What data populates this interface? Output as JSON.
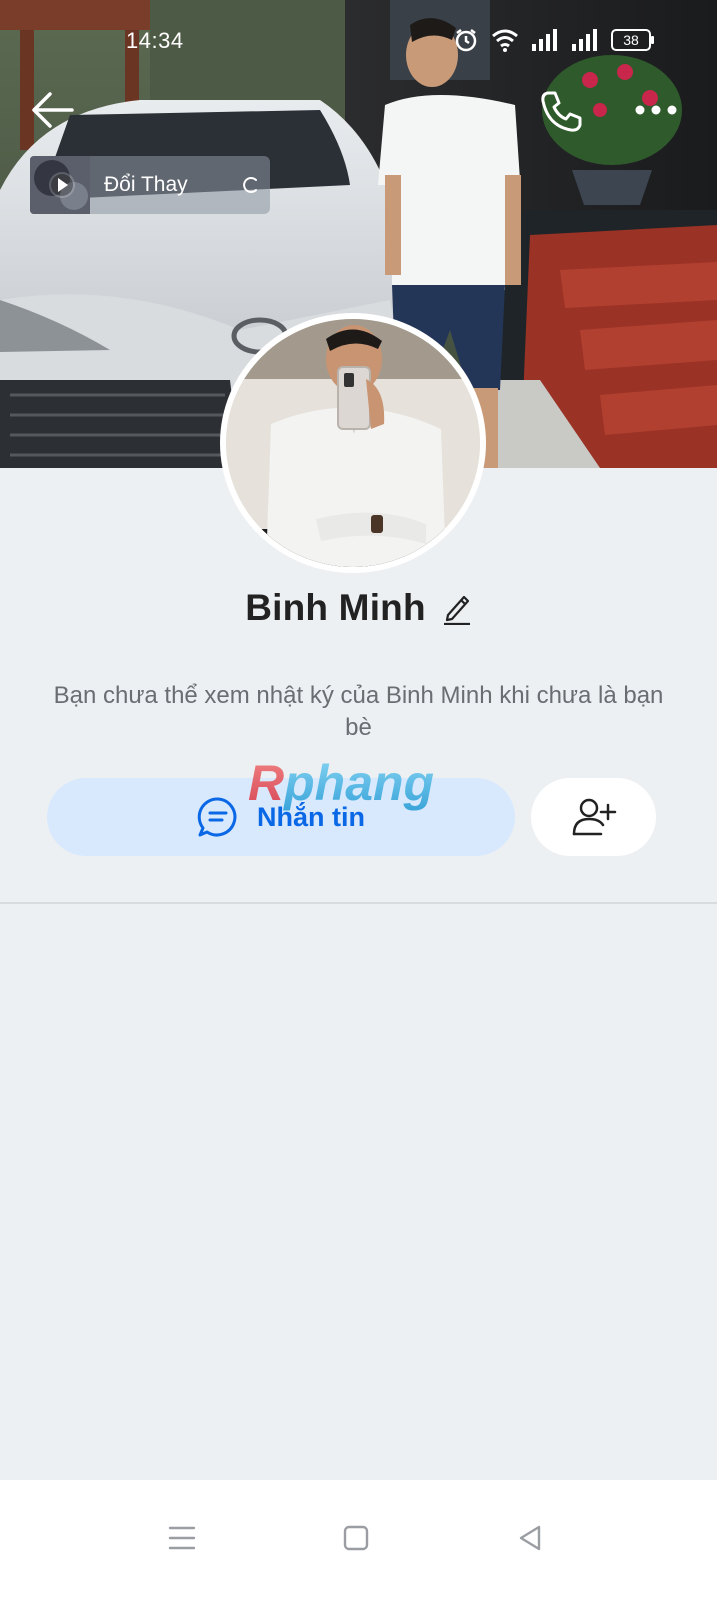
{
  "status_bar": {
    "time": "14:34",
    "battery_level": "38",
    "icons": [
      "alarm-icon",
      "wifi-icon",
      "signal-icon",
      "signal-icon",
      "battery-icon"
    ]
  },
  "header": {
    "back_icon": "arrow-left-icon",
    "call_icon": "phone-icon",
    "more_icon": "more-horizontal-icon"
  },
  "music": {
    "title": "Đổi Thay",
    "play_icon": "play-icon"
  },
  "profile": {
    "name": "Binh Minh",
    "edit_icon": "pencil-icon",
    "privacy_note": "Bạn chưa thể xem nhật ký của Binh Minh khi chưa là bạn bè"
  },
  "actions": {
    "message_label": "Nhắn tin",
    "message_icon": "chat-bubble-icon",
    "add_friend_icon": "add-friend-icon"
  },
  "watermark": {
    "text": "Rphang"
  },
  "nav_bar": {
    "items": [
      "menu-icon",
      "home-square-icon",
      "back-triangle-icon"
    ]
  },
  "colors": {
    "accent": "#0a68e6",
    "message_button_bg": "#d8e9fd",
    "page_bg": "#edf0f2",
    "text_primary": "#222222",
    "text_secondary": "#6a6d72"
  }
}
